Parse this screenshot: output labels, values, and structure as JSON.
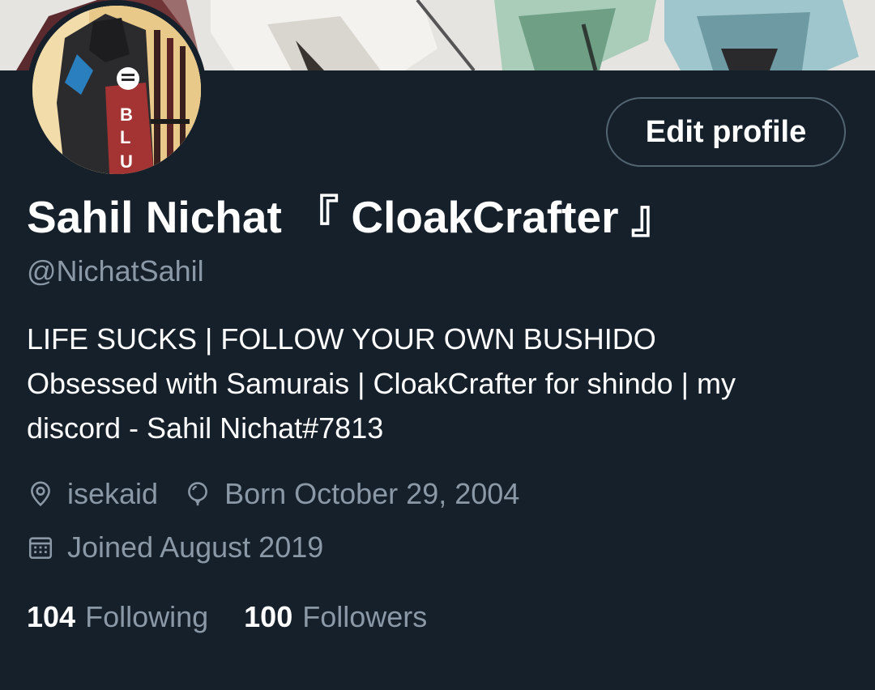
{
  "profile": {
    "display_name": "Sahil Nichat 『 CloakCrafter 』",
    "handle": "@NichatSahil",
    "bio_lines": [
      "LIFE SUCKS | FOLLOW YOUR OWN BUSHIDO",
      "Obsessed with Samurais | CloakCrafter for shindo | my",
      "discord - Sahil Nichat#7813"
    ],
    "location": "isekaid",
    "birthday": "Born October 29, 2004",
    "joined": "Joined August 2019"
  },
  "actions": {
    "edit_profile_label": "Edit profile"
  },
  "stats": {
    "following_count": "104",
    "following_label": "Following",
    "followers_count": "100",
    "followers_label": "Followers"
  },
  "icons": {
    "location": "location-pin-icon",
    "birthday": "balloon-icon",
    "joined": "calendar-icon"
  },
  "colors": {
    "background": "#15202b",
    "primary_text": "#ffffff",
    "secondary_text": "#8b98a5",
    "button_border": "#536471"
  }
}
